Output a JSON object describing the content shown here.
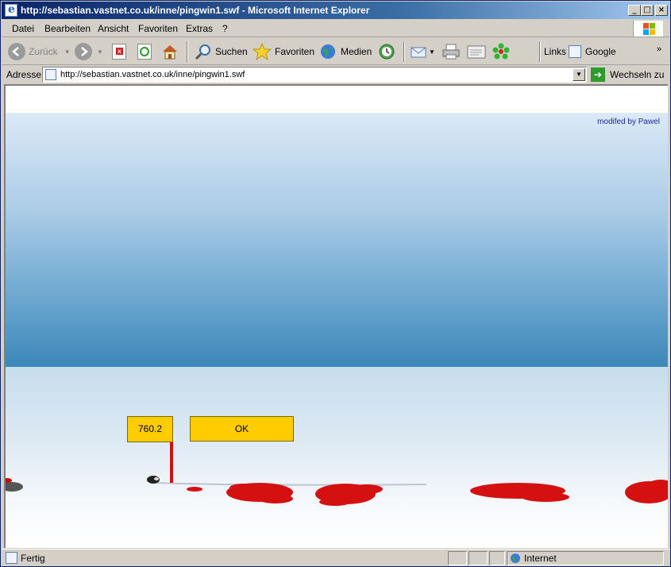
{
  "window": {
    "title": "http://sebastian.vastnet.co.uk/inne/pingwin1.swf - Microsoft Internet Explorer",
    "min_label": "_",
    "max_label": "□",
    "close_label": "×"
  },
  "menu": {
    "items": [
      "Datei",
      "Bearbeiten",
      "Ansicht",
      "Favoriten",
      "Extras",
      "?"
    ]
  },
  "toolbar": {
    "back_label": "Zurück",
    "search_label": "Suchen",
    "favorites_label": "Favoriten",
    "media_label": "Medien",
    "links_label": "Links",
    "google_label": "Google",
    "more_label": "»"
  },
  "address": {
    "label": "Adresse",
    "url": "http://sebastian.vastnet.co.uk/inne/pingwin1.swf",
    "go_label": "Wechseln zu"
  },
  "game": {
    "credit": "modifed by Pawel",
    "distance": "760.2",
    "ok_label": "OK",
    "colors": {
      "sky_top": "#dbe9f7",
      "sky_bottom": "#3b87b9",
      "box": "#ffcc00",
      "blood": "#d41010"
    }
  },
  "status": {
    "text": "Fertig",
    "zone": "Internet"
  }
}
